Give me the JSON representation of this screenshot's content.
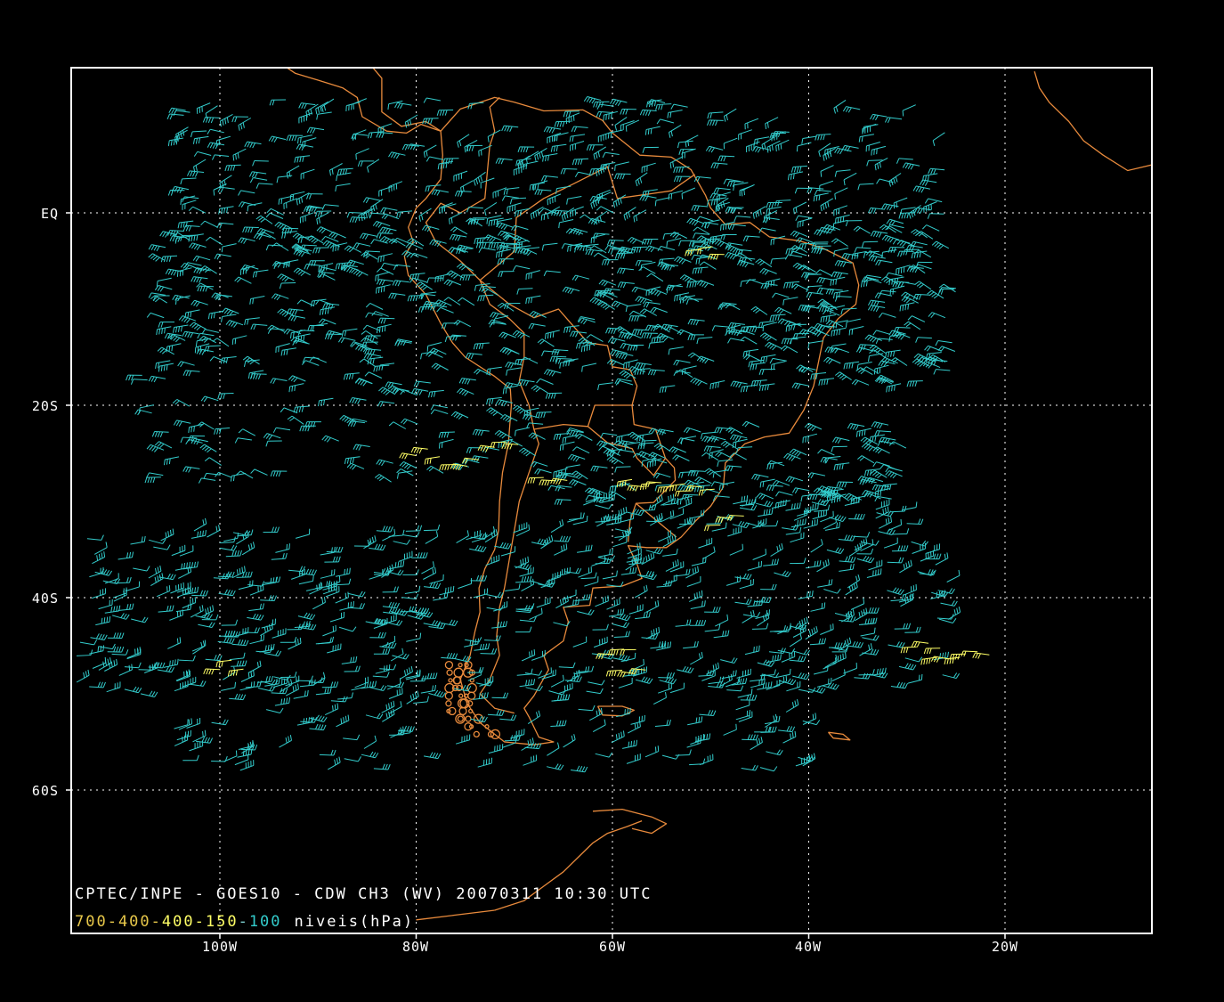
{
  "title": "CPTEC/INPE - GOES10 - CDW CH3 (WV) 20070311 10:30 UTC",
  "legend": {
    "levels": [
      {
        "label": "700-400",
        "color": "#e8c84a"
      },
      {
        "label": "-",
        "color": "#e8c84a"
      },
      {
        "label": "400-150",
        "color": "#ffff66"
      },
      {
        "label": "-",
        "color": "#7fd0d0"
      },
      {
        "label": "100",
        "color": "#33cccc"
      }
    ],
    "units_label": "niveis(hPa)"
  },
  "axes": {
    "lon_labels": [
      "100W",
      "80W",
      "60W",
      "40W",
      "20W"
    ],
    "lat_labels": [
      "EQ",
      "20S",
      "40S",
      "60S"
    ]
  },
  "colors": {
    "background": "#000000",
    "frame": "#ffffff",
    "grid": "#ffffff",
    "coastline": "#e88a3c",
    "wind_high": "#33cccc",
    "wind_low": "#ffff66"
  }
}
